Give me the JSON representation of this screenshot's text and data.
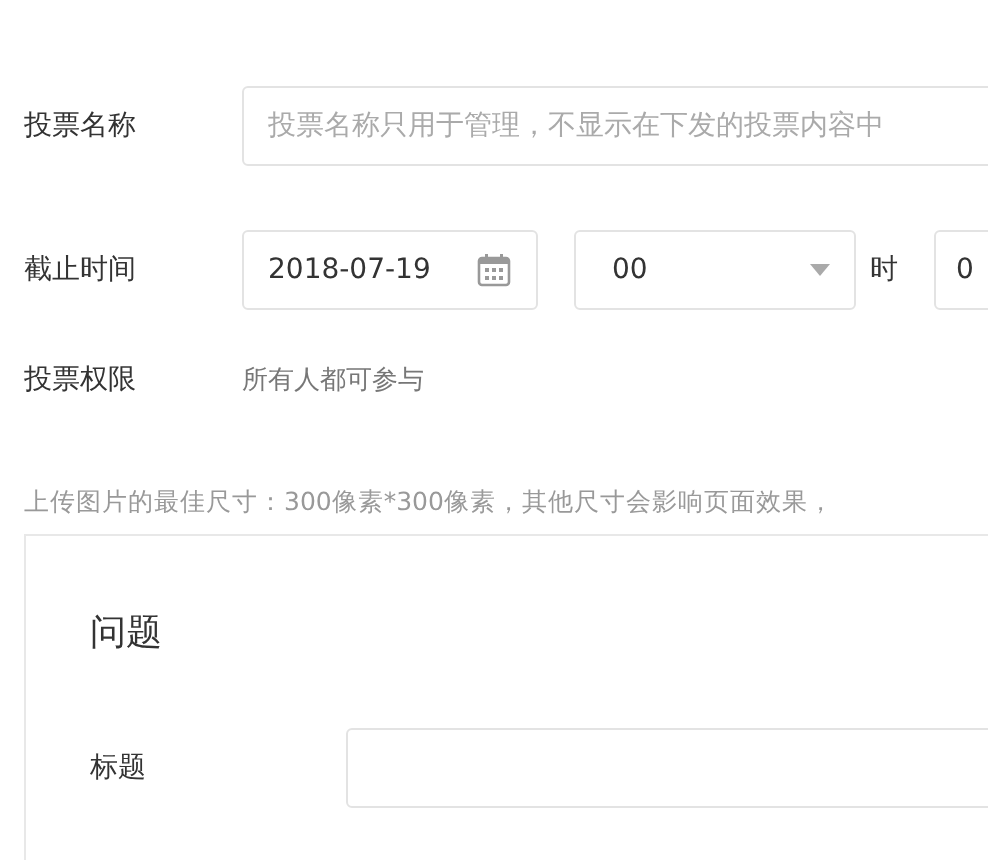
{
  "form": {
    "name": {
      "label": "投票名称",
      "placeholder": "投票名称只用于管理，不显示在下发的投票内容中"
    },
    "deadline": {
      "label": "截止时间",
      "date": "2018-07-19",
      "hour": "00",
      "hour_unit": "时",
      "minute": "0"
    },
    "permission": {
      "label": "投票权限",
      "value": "所有人都可参与"
    }
  },
  "upload_hint": "上传图片的最佳尺寸：300像素*300像素，其他尺寸会影响页面效果，",
  "question": {
    "heading": "问题",
    "title_label": "标题"
  }
}
